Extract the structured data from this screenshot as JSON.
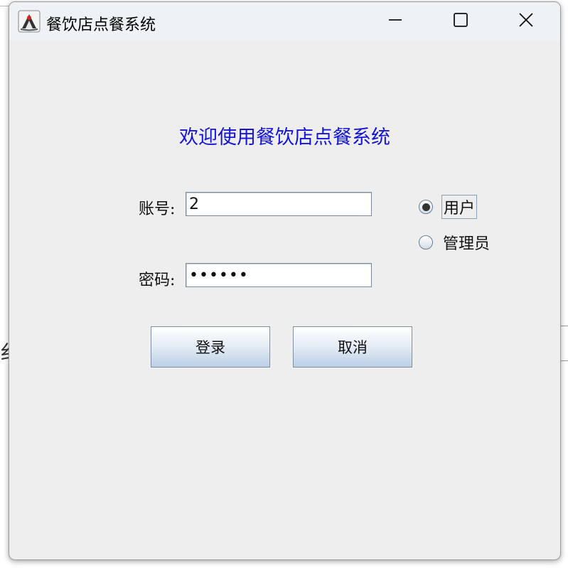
{
  "window": {
    "title": "餐饮店点餐系统",
    "icons": {
      "app": "java-app-icon",
      "minimize": "minimize-icon",
      "maximize": "maximize-icon",
      "close": "close-icon"
    }
  },
  "login": {
    "heading": "欢迎使用餐饮店点餐系统",
    "account_label": "账号:",
    "account_value": "2",
    "password_label": "密码:",
    "password_value": "••••••",
    "role_options": [
      {
        "label": "用户",
        "selected": true
      },
      {
        "label": "管理员",
        "selected": false
      }
    ],
    "login_button": "登录",
    "cancel_button": "取消"
  },
  "colors": {
    "heading": "#1414d8",
    "window_bg": "#eeeeee",
    "titlebar_bg": "#eef2f6"
  }
}
